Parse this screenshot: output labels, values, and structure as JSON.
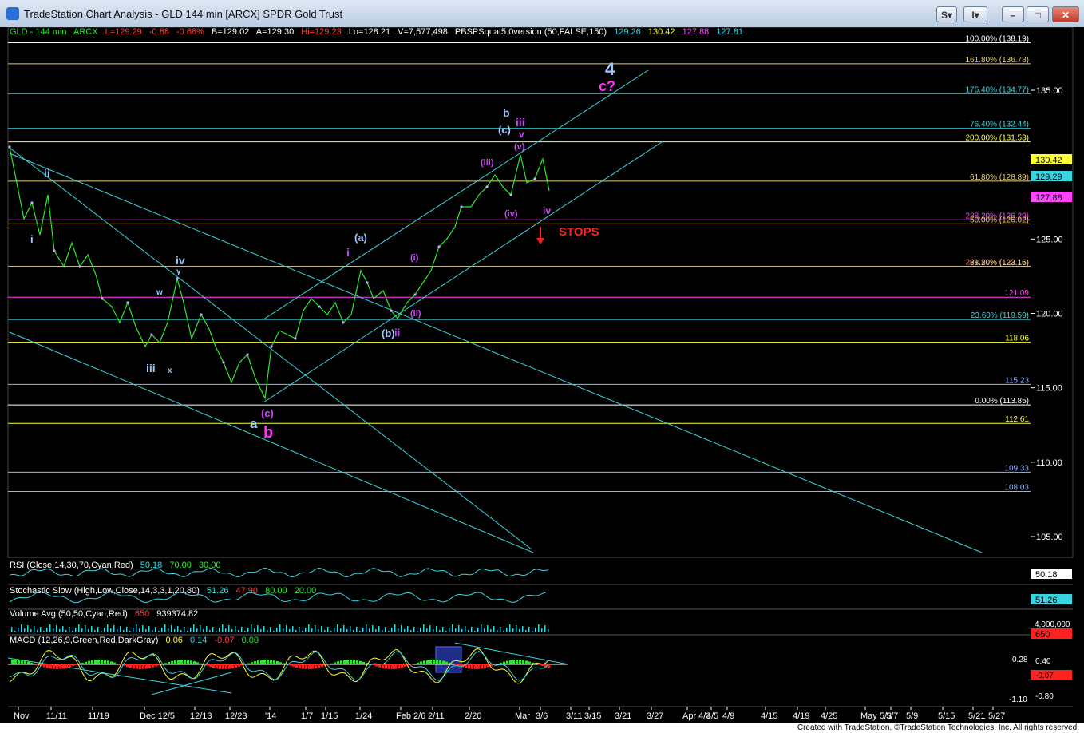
{
  "window": {
    "title": "TradeStation Chart Analysis - GLD 144 min [ARCX] SPDR Gold Trust",
    "buttons": {
      "s": "S",
      "i": "I"
    }
  },
  "header": {
    "symbol": "GLD - 144 min",
    "exchange": "ARCX",
    "last": "L=129.29",
    "change": "-0.88",
    "change_pct": "-0.68%",
    "bid": "B=129.02",
    "ask": "A=129.30",
    "hi": "Hi=129.23",
    "lo": "Lo=128.21",
    "volume": "V=7,577,498",
    "indicator": "PBSPSquat5.0version (50,FALSE,150)",
    "ind_v1": "129.26",
    "ind_v2": "130.42",
    "ind_v3": "127.88",
    "ind_v4": "127.81"
  },
  "price_axis": {
    "ticks": [
      "135.00",
      "125.00",
      "120.00",
      "115.00",
      "110.00",
      "105.00"
    ],
    "current": "129.29",
    "upper_tag": "130.42",
    "lower_tag": "127.88"
  },
  "levels": [
    {
      "label": "100.00% (138.19)",
      "color": "#ffffff"
    },
    {
      "label": "161.80% (136.78)",
      "color": "#e8d06a"
    },
    {
      "label": "176.40% (134.77)",
      "color": "#38d6e0"
    },
    {
      "label": "76.40% (132.44)",
      "color": "#38d6e0"
    },
    {
      "label": "200.00% (131.53)",
      "color": "#ffff33"
    },
    {
      "label": "61.80% (128.89)",
      "color": "#e8d06a"
    },
    {
      "label": "238.20% (126.29)",
      "color": "#ff44ff"
    },
    {
      "label": "50.00% (126.02)",
      "color": "#e8d06a"
    },
    {
      "label": "261.80% (123.16)",
      "color": "#ff6b6b"
    },
    {
      "label": "38.20% (123.15)",
      "color": "#e8d06a"
    },
    {
      "label": "121.09",
      "color": "#ff44ff"
    },
    {
      "label": "23.60% (119.59)",
      "color": "#38d6e0"
    },
    {
      "label": "118.06",
      "color": "#ffff33"
    },
    {
      "label": "115.23",
      "color": "#8fb4ff"
    },
    {
      "label": "0.00% (113.85)",
      "color": "#ffffff"
    },
    {
      "label": "112.61",
      "color": "#ffff33"
    },
    {
      "label": "109.33",
      "color": "#8fb4ff"
    },
    {
      "label": "108.03",
      "color": "#8fb4ff"
    }
  ],
  "wave_labels": [
    {
      "t": "4",
      "color": "#9fc7ff"
    },
    {
      "t": "c?",
      "color": "#ff33ff"
    },
    {
      "t": "b",
      "color": "#9fc7ff"
    },
    {
      "t": "(c)",
      "color": "#9fc7ff"
    },
    {
      "t": "iii",
      "color": "#cc44ff"
    },
    {
      "t": "v",
      "color": "#cc44ff"
    },
    {
      "t": "(v)",
      "color": "#cc44ff"
    },
    {
      "t": "(iii)",
      "color": "#cc44ff"
    },
    {
      "t": "(iv)",
      "color": "#cc44ff"
    },
    {
      "t": "iv",
      "color": "#cc44ff"
    },
    {
      "t": "ii",
      "color": "#9fc7ff"
    },
    {
      "t": "i",
      "color": "#9fc7ff"
    },
    {
      "t": "iv",
      "color": "#9fc7ff"
    },
    {
      "t": "y",
      "color": "#9fc7ff"
    },
    {
      "t": "w",
      "color": "#9fc7ff"
    },
    {
      "t": "iii",
      "color": "#9fc7ff"
    },
    {
      "t": "x",
      "color": "#9fc7ff"
    },
    {
      "t": "(a)",
      "color": "#9fc7ff"
    },
    {
      "t": "i",
      "color": "#cc44ff"
    },
    {
      "t": "(i)",
      "color": "#cc44ff"
    },
    {
      "t": "(ii)",
      "color": "#cc44ff"
    },
    {
      "t": "(b)",
      "color": "#9fc7ff"
    },
    {
      "t": "ii",
      "color": "#cc44ff"
    },
    {
      "t": "(c)",
      "color": "#cc44ff"
    },
    {
      "t": "a",
      "color": "#9fc7ff"
    },
    {
      "t": "b",
      "color": "#ff33ff"
    }
  ],
  "stops_label": "STOPS",
  "indicators": {
    "rsi": {
      "name": "RSI (Close,14,30,70,Cyan,Red)",
      "v1": "50.18",
      "v2": "70.00",
      "v3": "30.00",
      "tag": "50.18"
    },
    "stoch": {
      "name": "Stochastic Slow (High,Low,Close,14,3,3,1,20,80)",
      "v1": "51.26",
      "v2": "47.90",
      "v3": "80.00",
      "v4": "20.00",
      "tag": "51.26"
    },
    "volume": {
      "name": "Volume Avg (50,50,Cyan,Red)",
      "v1": "650",
      "v2": "939374.82",
      "tag_top": "4,000,000",
      "tag": "650"
    },
    "macd": {
      "name": "MACD (12,26,9,Green,Red,DarkGray)",
      "v1": "0.06",
      "v2": "0.14",
      "v3": "-0.07",
      "v4": "0.00",
      "ticks": [
        "0.40",
        "-0.80"
      ],
      "tag1": "0.28",
      "tag2": "-0.07",
      "tag3": "-1.10"
    }
  },
  "date_axis": [
    "Nov",
    "11/11",
    "11/19",
    "Dec 12/5",
    "12/13",
    "12/23",
    "'14",
    "1/7",
    "1/15",
    "1/24",
    "Feb 2/6",
    "2/11",
    "2/20",
    "Mar",
    "3/6",
    "3/11",
    "3/15",
    "3/21",
    "3/27",
    "Apr 4/3",
    "4/5",
    "4/9",
    "4/15",
    "4/19",
    "4/25",
    "May 5/3",
    "5/7",
    "5/9",
    "5/15",
    "5/21",
    "5/27"
  ],
  "footer": "Created with TradeStation. ©TradeStation Technologies, Inc. All rights reserved."
}
